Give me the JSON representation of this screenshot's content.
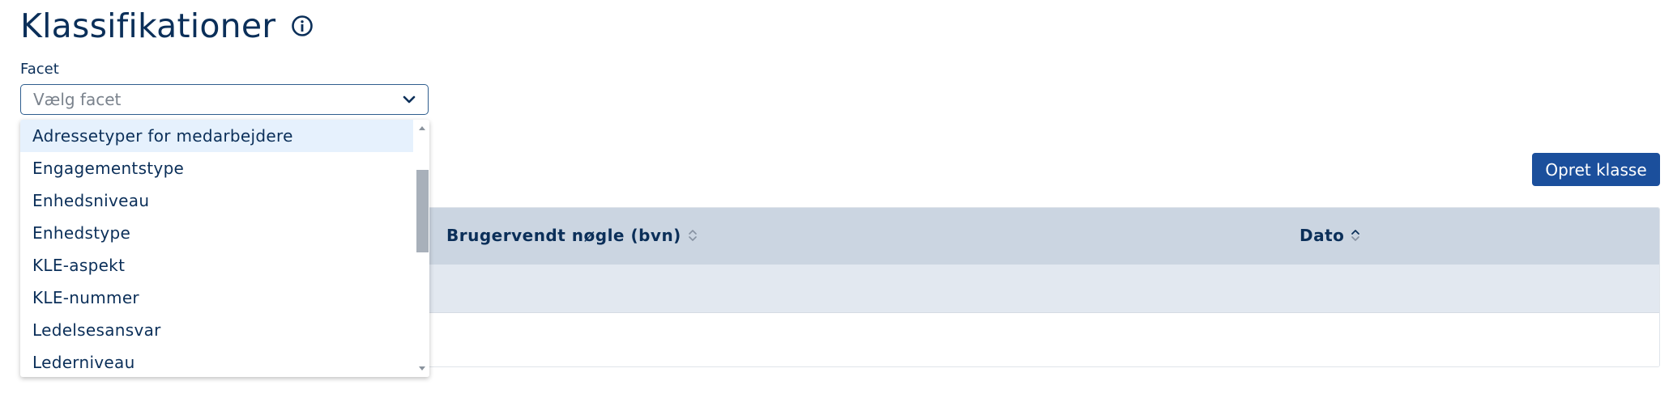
{
  "header": {
    "title": "Klassifikationer",
    "info_icon": "info-circle-icon"
  },
  "facet": {
    "label": "Facet",
    "placeholder": "Vælg facet",
    "chevron_icon": "chevron-down-icon",
    "options": [
      "Adressetyper for medarbejdere",
      "Engagementstype",
      "Enhedsniveau",
      "Enhedstype",
      "KLE-aspekt",
      "KLE-nummer",
      "Ledelsesansvar",
      "Lederniveau"
    ],
    "highlighted_index": 0
  },
  "toolbar": {
    "create_label": "Opret klasse"
  },
  "table": {
    "columns": [
      {
        "label": "Brugervendt nøgle (bvn)",
        "sort_icon": "sort-both-icon"
      },
      {
        "label": "Dato",
        "sort_icon": "sort-both-icon"
      }
    ]
  },
  "colors": {
    "primary": "#1b4f9c",
    "text": "#0b2f59",
    "header_bg": "#cbd5e1",
    "row_bg": "#e2e8f0",
    "highlight": "#e6f1fd"
  }
}
